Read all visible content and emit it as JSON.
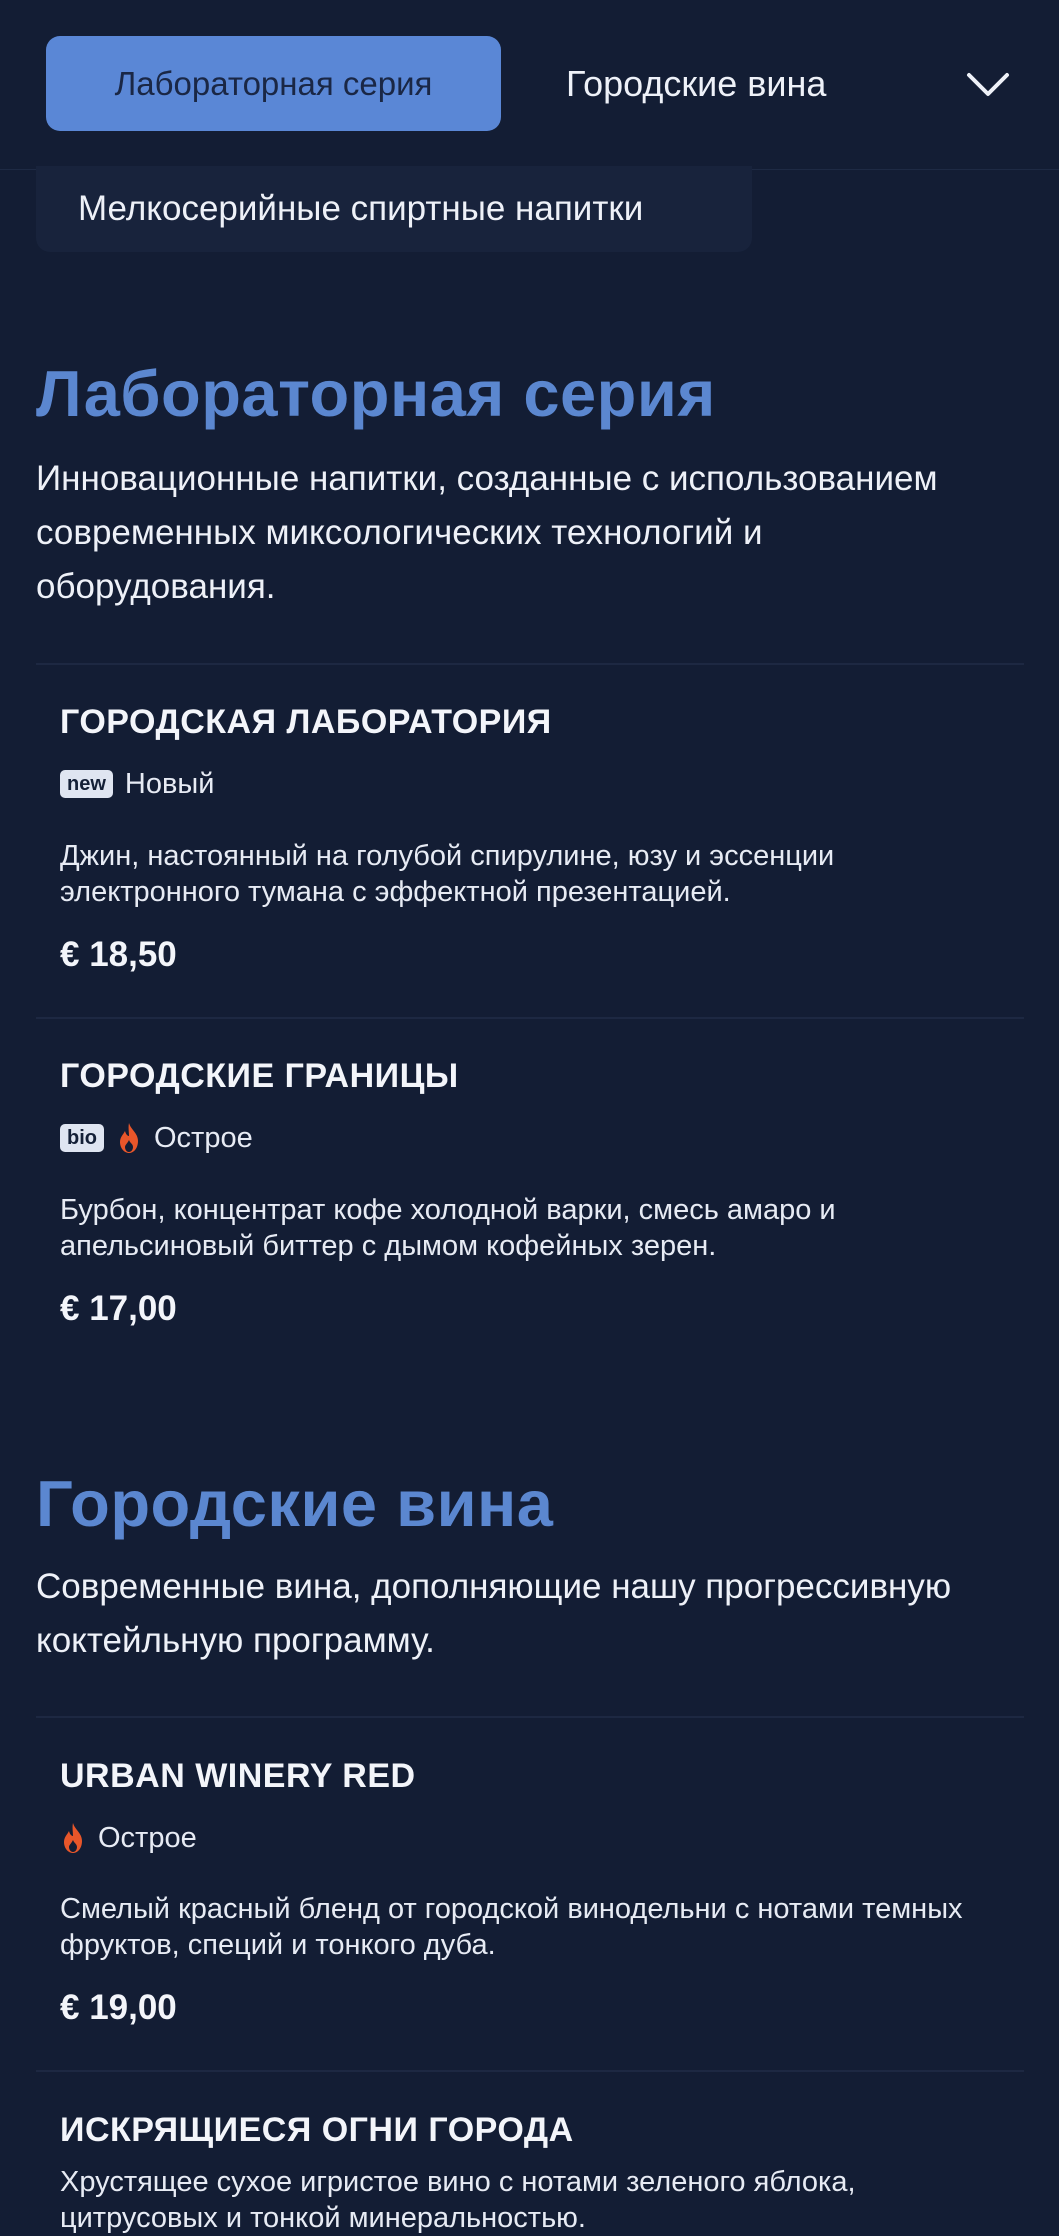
{
  "nav": {
    "tabs": [
      {
        "label": "Лабораторная серия",
        "active": true
      },
      {
        "label": "Городские вина",
        "active": false
      }
    ],
    "dropdown_items": [
      {
        "label": "Мелкосерийные спиртные напитки"
      }
    ]
  },
  "sections": [
    {
      "title": "Лабораторная серия",
      "description": "Инновационные напитки, созданные с использованием современных миксологических технологий и оборудования.",
      "items": [
        {
          "name": "ГОРОДСКАЯ ЛАБОРАТОРИЯ",
          "badge": "new",
          "tag": "Новый",
          "description": "Джин, настоянный на голубой спирулине, юзу и эссенции электронного тумана с эффектной презентацией.",
          "price": "€ 18,50"
        },
        {
          "name": "ГОРОДСКИЕ ГРАНИЦЫ",
          "badge": "bio",
          "tag": "Острое",
          "description": "Бурбон, концентрат кофе холодной варки, смесь амаро и апельсиновый биттер с дымом кофейных зерен.",
          "price": "€ 17,00"
        }
      ]
    },
    {
      "title": "Городские вина",
      "description": "Современные вина, дополняющие нашу прогрессивную коктейльную программу.",
      "items": [
        {
          "name": "URBAN WINERY RED",
          "tag": "Острое",
          "description": "Смелый красный бленд от городской винодельни с нотами темных фруктов, специй и тонкого дуба.",
          "price": "€ 19,00"
        },
        {
          "name": "ИСКРЯЩИЕСЯ ОГНИ ГОРОДА",
          "description": "Хрустящее сухое игристое вино с нотами зеленого яблока, цитрусовых и тонкой минеральностью."
        }
      ]
    }
  ],
  "icons": {
    "chevron": "chevron-down-icon",
    "spicy": "flame-icon"
  },
  "colors": {
    "background": "#131d34",
    "accent": "#5b87d0",
    "active_tab": "#5a87d6",
    "flame": "#e8562a"
  }
}
